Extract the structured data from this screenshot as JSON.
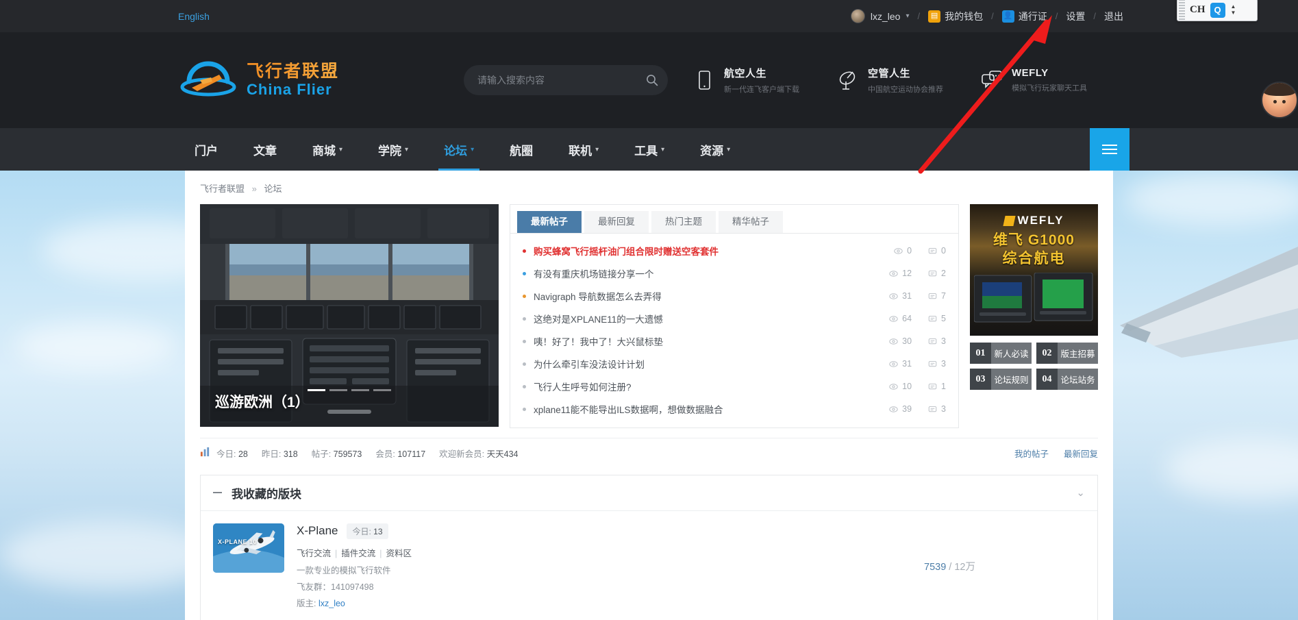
{
  "topbar": {
    "language": "English",
    "username": "lxz_leo",
    "links": [
      {
        "label": "我的钱包",
        "icon": "wallet-icon"
      },
      {
        "label": "通行证",
        "icon": "passport-icon"
      },
      {
        "label": "设置",
        "icon": null
      },
      {
        "label": "退出",
        "icon": null
      }
    ],
    "separator": "/"
  },
  "ime": {
    "mode": "CH",
    "button": "Q"
  },
  "header": {
    "logo_cn": "飞行者联盟",
    "logo_en": "China Flier",
    "search_placeholder": "请输入搜索内容",
    "search_value": "",
    "search_icon": "search-icon",
    "apps": [
      {
        "title": "航空人生",
        "subtitle": "新一代连飞客户端下载",
        "icon": "phone-icon"
      },
      {
        "title": "空管人生",
        "subtitle": "中国航空运动协会推荐",
        "icon": "radar-dish-icon"
      },
      {
        "title": "WEFLY",
        "subtitle": "模拟飞行玩家聊天工具",
        "icon": "chat-bubbles-icon"
      }
    ]
  },
  "nav": {
    "items": [
      {
        "label": "门户",
        "has_dropdown": false,
        "active": false
      },
      {
        "label": "文章",
        "has_dropdown": false,
        "active": false
      },
      {
        "label": "商城",
        "has_dropdown": true,
        "active": false
      },
      {
        "label": "学院",
        "has_dropdown": true,
        "active": false
      },
      {
        "label": "论坛",
        "has_dropdown": true,
        "active": true
      },
      {
        "label": "航圈",
        "has_dropdown": false,
        "active": false
      },
      {
        "label": "联机",
        "has_dropdown": true,
        "active": false
      },
      {
        "label": "工具",
        "has_dropdown": true,
        "active": false
      },
      {
        "label": "资源",
        "has_dropdown": true,
        "active": false
      }
    ],
    "menu_icon": "hamburger-icon",
    "accent": "#19a5e8"
  },
  "breadcrumb": {
    "root": "飞行者联盟",
    "sep": "»",
    "current": "论坛"
  },
  "carousel": {
    "caption": "巡游欧洲（1）",
    "slide_count": 4,
    "active_slide": 1
  },
  "posts": {
    "tabs": [
      {
        "label": "最新帖子",
        "active": true
      },
      {
        "label": "最新回复",
        "active": false
      },
      {
        "label": "热门主题",
        "active": false
      },
      {
        "label": "精华帖子",
        "active": false
      }
    ],
    "items": [
      {
        "title": "购买蜂窝飞行摇杆油门组合限时赠送空客套件",
        "views": "0",
        "replies": "0",
        "hot": true,
        "dot": "red"
      },
      {
        "title": "有没有重庆机场链接分享一个",
        "views": "12",
        "replies": "2",
        "hot": false,
        "dot": "blue"
      },
      {
        "title": "Navigraph 导航数据怎么去弄得",
        "views": "31",
        "replies": "7",
        "hot": false,
        "dot": "orange"
      },
      {
        "title": "这绝对是XPLANE11的一大遗憾",
        "views": "64",
        "replies": "5",
        "hot": false,
        "dot": "grey"
      },
      {
        "title": "咦！好了！我中了！大兴鼠标垫",
        "views": "30",
        "replies": "3",
        "hot": false,
        "dot": "grey"
      },
      {
        "title": "为什么牵引车没法设计计划",
        "views": "31",
        "replies": "3",
        "hot": false,
        "dot": "grey"
      },
      {
        "title": "飞行人生呼号如何注册?",
        "views": "10",
        "replies": "1",
        "hot": false,
        "dot": "grey"
      },
      {
        "title": "xplane11能不能导出ILS数据啊，想做数据融合",
        "views": "39",
        "replies": "3",
        "hot": false,
        "dot": "grey"
      }
    ],
    "view_icon": "eye-icon",
    "reply_icon": "comment-icon"
  },
  "ad": {
    "brand": "WEFLY",
    "line1": "维飞 G1000",
    "line2": "综合航电"
  },
  "tiles": [
    {
      "num": "01",
      "label": "新人必读"
    },
    {
      "num": "02",
      "label": "版主招募"
    },
    {
      "num": "03",
      "label": "论坛规则"
    },
    {
      "num": "04",
      "label": "论坛站务"
    }
  ],
  "stats": {
    "icon": "bar-chart-icon",
    "entries": [
      {
        "key": "今日:",
        "value": "28"
      },
      {
        "key": "昨日:",
        "value": "318"
      },
      {
        "key": "帖子:",
        "value": "759573"
      },
      {
        "key": "会员:",
        "value": "107117"
      }
    ],
    "welcome_label": "欢迎新会员:",
    "welcome_member": "天天434",
    "right_links": [
      "我的帖子",
      "最新回复"
    ]
  },
  "favorites": {
    "title": "我收藏的版块",
    "collapse_icon": "minus-icon",
    "chevron_icon": "chevron-down-icon",
    "forums": [
      {
        "name": "X-Plane",
        "today_label": "今日:",
        "today_value": "13",
        "thumb_label": "X-PLANE 10",
        "sub_boards": [
          "飞行交流",
          "插件交流",
          "资料区"
        ],
        "description": "一款专业的模拟飞行软件",
        "qq_label": "飞友群：",
        "qq_value": "141097498",
        "mod_label": "版主:",
        "mod_value": "lxz_leo",
        "threads": "7539",
        "posts": "12万",
        "count_sep": "/"
      }
    ]
  }
}
